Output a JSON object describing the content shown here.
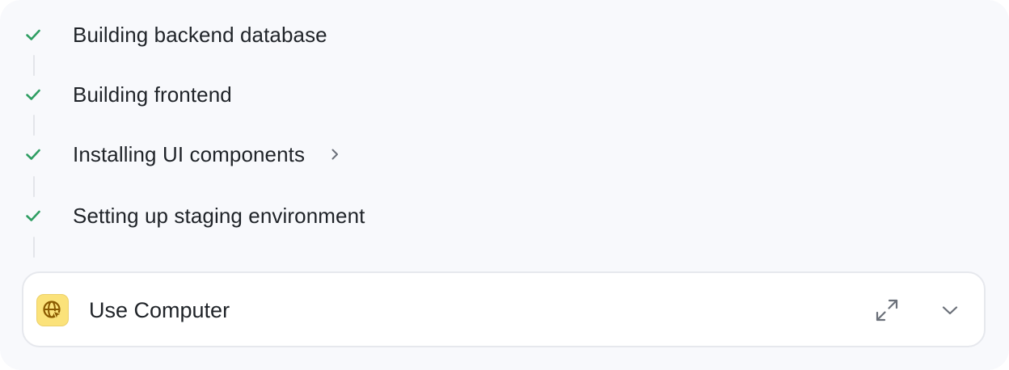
{
  "steps": [
    {
      "label": "Building backend database",
      "status": "done",
      "icon": "check-icon",
      "expandable": false
    },
    {
      "label": "Building frontend",
      "status": "done",
      "icon": "check-icon",
      "expandable": false
    },
    {
      "label": "Installing UI components",
      "status": "done",
      "icon": "check-icon",
      "expandable": true
    },
    {
      "label": "Setting up staging environment",
      "status": "done",
      "icon": "check-icon",
      "expandable": false
    }
  ],
  "tool": {
    "title": "Use Computer",
    "icon": "computer-use-icon",
    "expand_icon": "expand-icon",
    "collapse_icon": "chevron-down-icon"
  },
  "colors": {
    "check": "#2f9e63",
    "text": "#1f2328",
    "panel_bg": "#f8f9fc",
    "card_bg": "#ffffff",
    "icon_bg": "#fbe27a",
    "muted_icon": "#6b7079"
  }
}
